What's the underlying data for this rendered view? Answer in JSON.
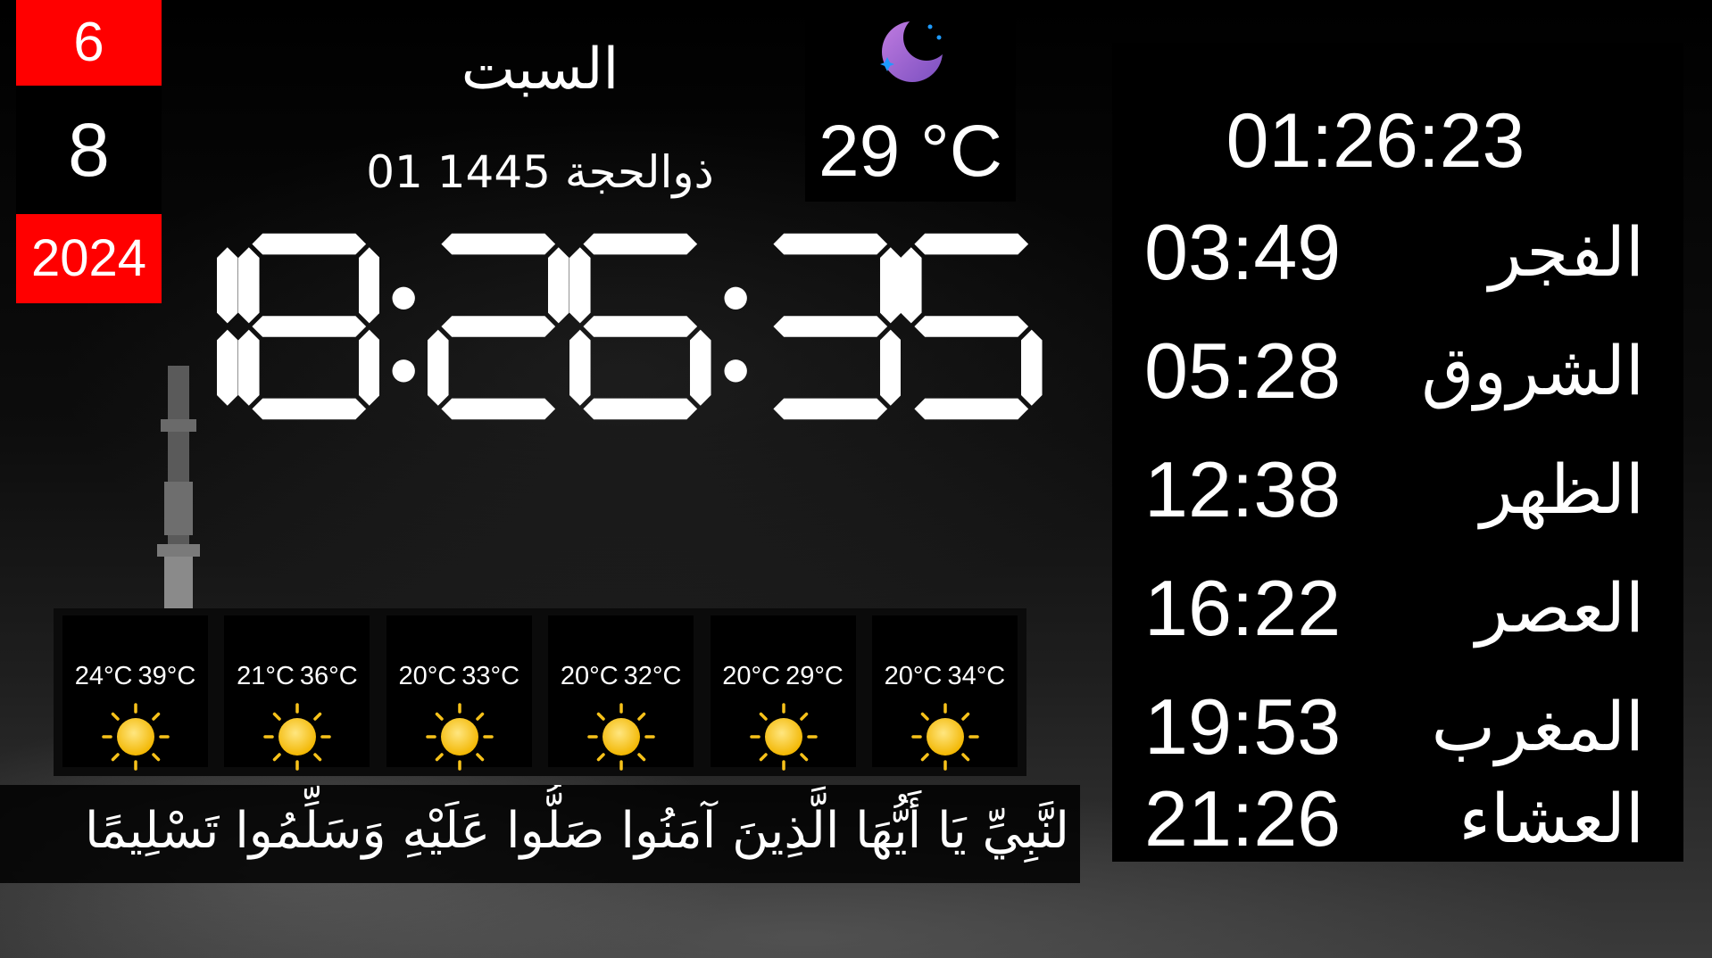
{
  "date": {
    "month": "6",
    "day": "8",
    "year": "2024"
  },
  "day_name": "السبت",
  "hijri_date": "01 ذوالحجة 1445",
  "weather": {
    "icon": "moon-night-icon",
    "current_temp": "29 °C"
  },
  "clock": {
    "digits": [
      "1",
      "8",
      "2",
      "6",
      "3",
      "5"
    ]
  },
  "forecast": [
    {
      "low": "24°C",
      "high": "39°C",
      "icon": "sun-icon"
    },
    {
      "low": "21°C",
      "high": "36°C",
      "icon": "sun-icon"
    },
    {
      "low": "20°C",
      "high": "33°C",
      "icon": "sun-icon"
    },
    {
      "low": "20°C",
      "high": "32°C",
      "icon": "sun-icon"
    },
    {
      "low": "20°C",
      "high": "29°C",
      "icon": "sun-icon"
    },
    {
      "low": "20°C",
      "high": "34°C",
      "icon": "sun-icon"
    }
  ],
  "quote": "لنَّبِيِّ يَا أَيُّهَا الَّذِينَ آمَنُوا صَلُّوا عَلَيْهِ وَسَلِّمُوا تَسْلِيمًا",
  "prayer": {
    "countdown": "01:26:23",
    "times": [
      {
        "name": "الفجر",
        "time": "03:49"
      },
      {
        "name": "الشروق",
        "time": "05:28"
      },
      {
        "name": "الظهر",
        "time": "12:38"
      },
      {
        "name": "العصر",
        "time": "16:22"
      },
      {
        "name": "المغرب",
        "time": "19:53"
      },
      {
        "name": "العشاء",
        "time": "21:26"
      }
    ]
  },
  "colors": {
    "accent_red": "#ff0000",
    "text": "#ffffff",
    "panel": "#000000"
  }
}
